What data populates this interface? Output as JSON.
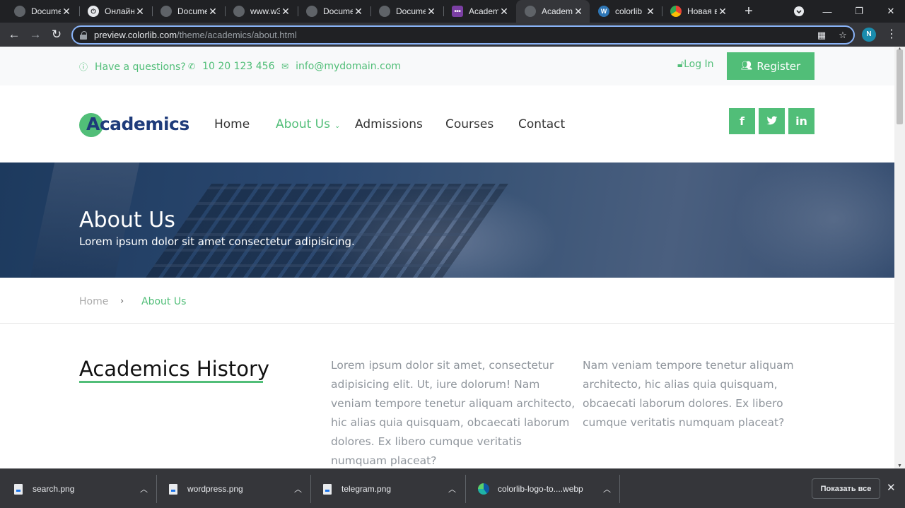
{
  "browser": {
    "tabs": [
      {
        "title": "Docume",
        "icon": "globe-icon"
      },
      {
        "title": "Онлайн",
        "icon": "pdf-icon"
      },
      {
        "title": "Docume",
        "icon": "globe-icon"
      },
      {
        "title": "www.w3",
        "icon": "globe-icon"
      },
      {
        "title": "Docume",
        "icon": "globe-icon"
      },
      {
        "title": "Docume",
        "icon": "globe-icon"
      },
      {
        "title": "Academ",
        "icon": "colorlib-icon"
      },
      {
        "title": "Academ",
        "icon": "globe-icon",
        "active": true
      },
      {
        "title": "colorlib",
        "icon": "wordpress-icon"
      },
      {
        "title": "Новая в",
        "icon": "chrome-icon"
      }
    ],
    "url_host": "preview.colorlib.com",
    "url_path": "/theme/academics/about.html",
    "profile_initial": "N"
  },
  "topbar": {
    "question": "Have a questions?",
    "phone": "10 20 123 456",
    "email": "info@mydomain.com",
    "login": "Log In",
    "register": "Register"
  },
  "nav": {
    "logo": "Academics",
    "items": [
      "Home",
      "About Us",
      "Admissions",
      "Courses",
      "Contact"
    ],
    "social": [
      "f",
      "t",
      "in"
    ]
  },
  "hero": {
    "title": "About Us",
    "subtitle": "Lorem ipsum dolor sit amet consectetur adipisicing."
  },
  "breadcrumb": {
    "home": "Home",
    "separator": "›",
    "current": "About Us"
  },
  "content": {
    "title": "Academics History",
    "para1_lines": [
      "Lorem ipsum dolor sit amet, consectetur",
      "adipisicing elit. Ut, iure dolorum! Nam",
      "veniam tempore tenetur aliquam architecto,",
      "hic alias quia quisquam, obcaecati laborum",
      "dolores. Ex libero cumque veritatis",
      "numquam placeat?"
    ],
    "para2_lines": [
      "Nam veniam tempore tenetur aliquam",
      "architecto, hic alias quia quisquam,",
      "obcaecati laborum dolores. Ex libero",
      "cumque veritatis numquam placeat?"
    ]
  },
  "downloads": {
    "items": [
      "search.png",
      "wordpress.png",
      "telegram.png",
      "colorlib-logo-to....webp"
    ],
    "show_all": "Показать все"
  },
  "colors": {
    "accent": "#51be78",
    "logo_blue": "#1e3b7a",
    "hero_overlay": "#2b4870"
  }
}
